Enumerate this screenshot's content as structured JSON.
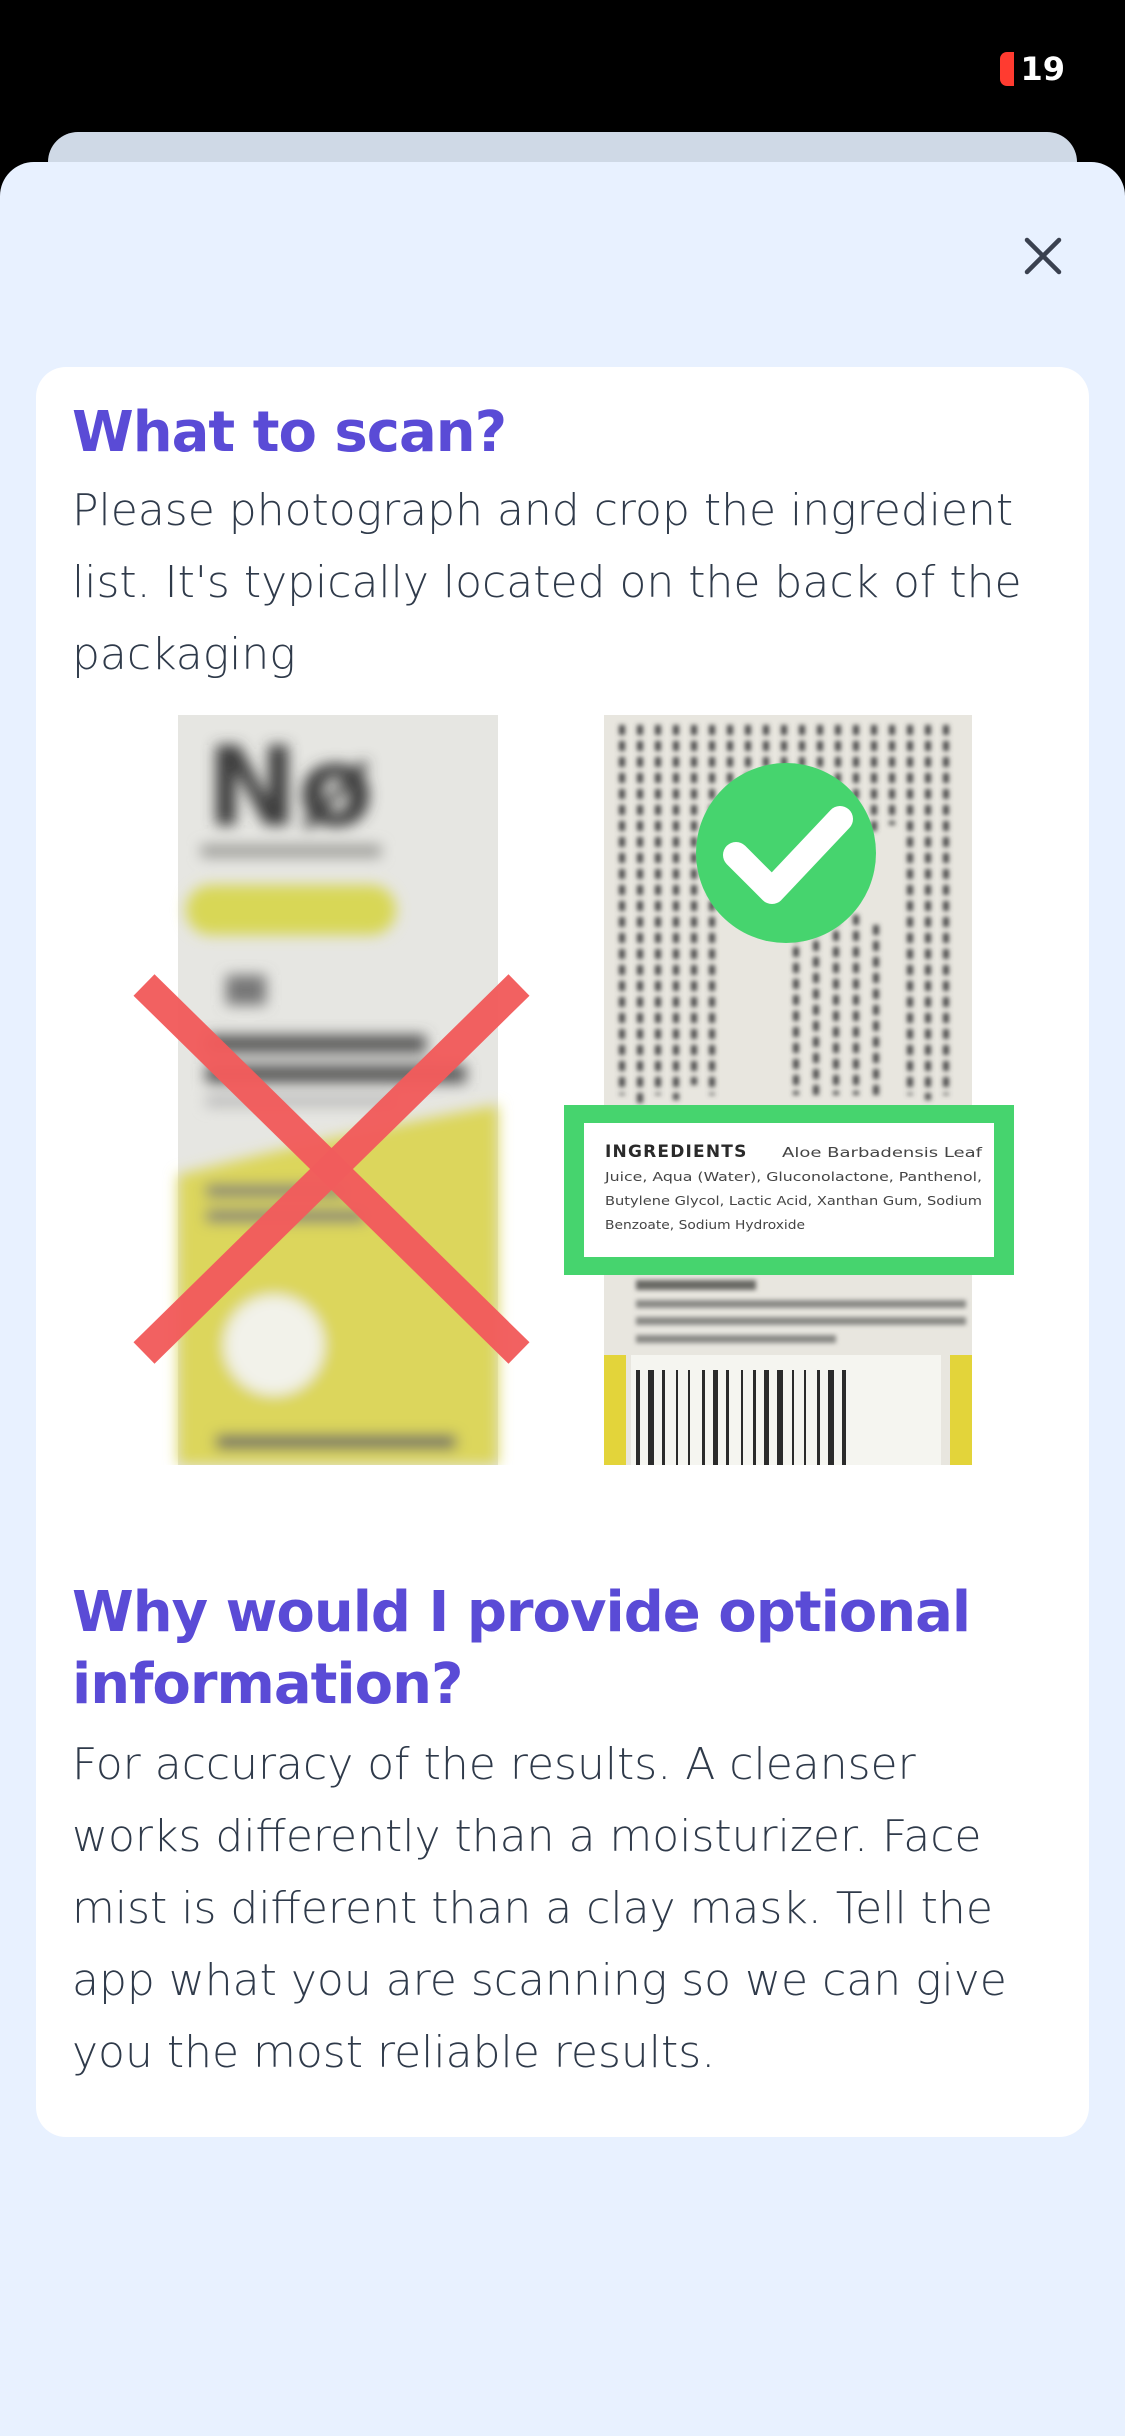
{
  "status_bar": {
    "battery_level": "19",
    "battery_color": "#ff3b30"
  },
  "sheet": {
    "close_icon": "close-icon",
    "background": "#e8f1ff"
  },
  "card_scan": {
    "title": "What to scan?",
    "text": "Please photograph and crop the ingredient list. It's typically located on the back of the packaging",
    "illustration": {
      "wrong": {
        "brand_text": "Nø",
        "icon": "cross-mark-icon",
        "color": "#f25c5c"
      },
      "right": {
        "icon": "checkmark-icon",
        "color": "#46d46e",
        "ingredients_heading": "INGREDIENTS",
        "ingredients_lines": [
          "Aloe Barbadensis Leaf",
          "Juice, Aqua (Water), Gluconolactone, Panthenol,",
          "Butylene Glycol, Lactic Acid, Xanthan Gum, Sodium",
          "Benzoate, Sodium Hydroxide"
        ]
      }
    }
  },
  "card_optional": {
    "title": "Why would I provide optional information?",
    "text": "For accuracy of the results. A cleanser works differently than a moisturizer. Face mist is different than a clay mask. Tell the app what you are scanning so we can give you the most reliable results."
  },
  "colors": {
    "title": "#5a4bd6",
    "body_text": "#2f3a4a",
    "card_bg": "#ffffff"
  }
}
